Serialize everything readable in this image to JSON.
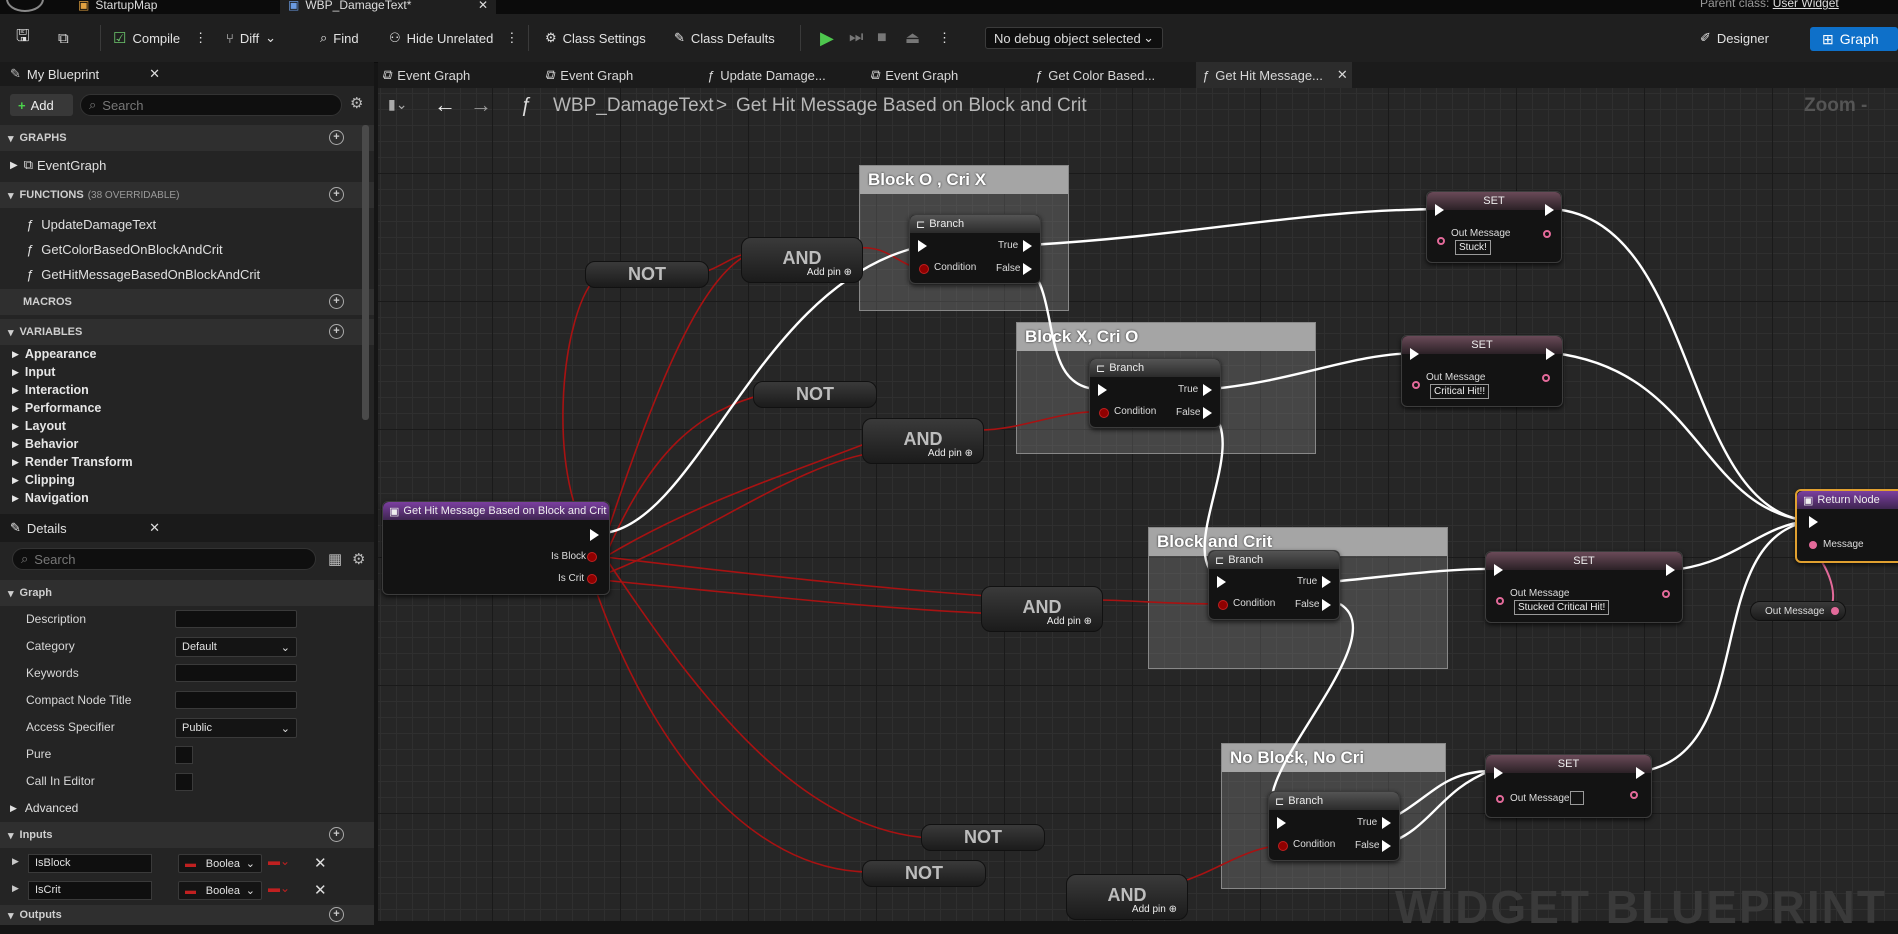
{
  "tabs": {
    "startup_map": "StartupMap",
    "blueprint": "WBP_DamageText*",
    "parent_class_label": "Parent class:",
    "parent_class_value": "User Widget"
  },
  "toolbar": {
    "compile": "Compile",
    "diff": "Diff",
    "find": "Find",
    "hide_unrelated": "Hide Unrelated",
    "class_settings": "Class Settings",
    "class_defaults": "Class Defaults",
    "debug_object": "No debug object selected",
    "designer": "Designer",
    "graph": "Graph"
  },
  "my_blueprint": {
    "tab": "My Blueprint",
    "add": "Add",
    "search_placeholder": "Search",
    "graphs_header": "GRAPHS",
    "graphs": [
      "EventGraph"
    ],
    "functions_header": "FUNCTIONS",
    "functions_overridable": "(38 OVERRIDABLE)",
    "functions": [
      "UpdateDamageText",
      "GetColorBasedOnBlockAndCrit",
      "GetHitMessageBasedOnBlockAndCrit"
    ],
    "macros_header": "MACROS",
    "variables_header": "VARIABLES",
    "variables": [
      "Appearance",
      "Input",
      "Interaction",
      "Performance",
      "Layout",
      "Behavior",
      "Render Transform",
      "Clipping",
      "Navigation"
    ]
  },
  "details": {
    "tab": "Details",
    "search_placeholder": "Search",
    "graph_section": "Graph",
    "description": "Description",
    "category": "Category",
    "category_value": "Default",
    "keywords": "Keywords",
    "compact_node_title": "Compact Node Title",
    "access_specifier": "Access Specifier",
    "access_value": "Public",
    "pure": "Pure",
    "call_in_editor": "Call In Editor",
    "advanced": "Advanced",
    "inputs_section": "Inputs",
    "inputs": [
      {
        "name": "IsBlock",
        "type": "Boolea"
      },
      {
        "name": "IsCrit",
        "type": "Boolea"
      }
    ],
    "outputs_section": "Outputs"
  },
  "graph_tabs": [
    "Event Graph",
    "Event Graph",
    "Update Damage...",
    "Event Graph",
    "Get Color Based...",
    "Get Hit Message..."
  ],
  "breadcrumb": {
    "blueprint": "WBP_DamageText",
    "sep": ">",
    "function": "Get Hit Message Based on Block and Crit",
    "zoom": "Zoom -"
  },
  "comments": {
    "c1": "Block O , Cri X",
    "c2": "Block X, Cri O",
    "c3": "Block and Crit",
    "c4": "No Block, No Cri"
  },
  "nodes": {
    "entry_title": "Get Hit Message Based on Block and Crit",
    "is_block": "Is Block",
    "is_crit": "Is Crit",
    "branch": "Branch",
    "true": "True",
    "false": "False",
    "condition": "Condition",
    "and": "AND",
    "not": "NOT",
    "add_pin": "Add pin",
    "set": "SET",
    "out_message": "Out Message",
    "msg_stuck": "Stuck!",
    "msg_critical": "Critical Hit!!",
    "msg_stucked_critical": "Stucked Critical Hit!",
    "return_node": "Return Node",
    "message": "Message"
  },
  "watermark": "WIDGET BLUEPRINT"
}
